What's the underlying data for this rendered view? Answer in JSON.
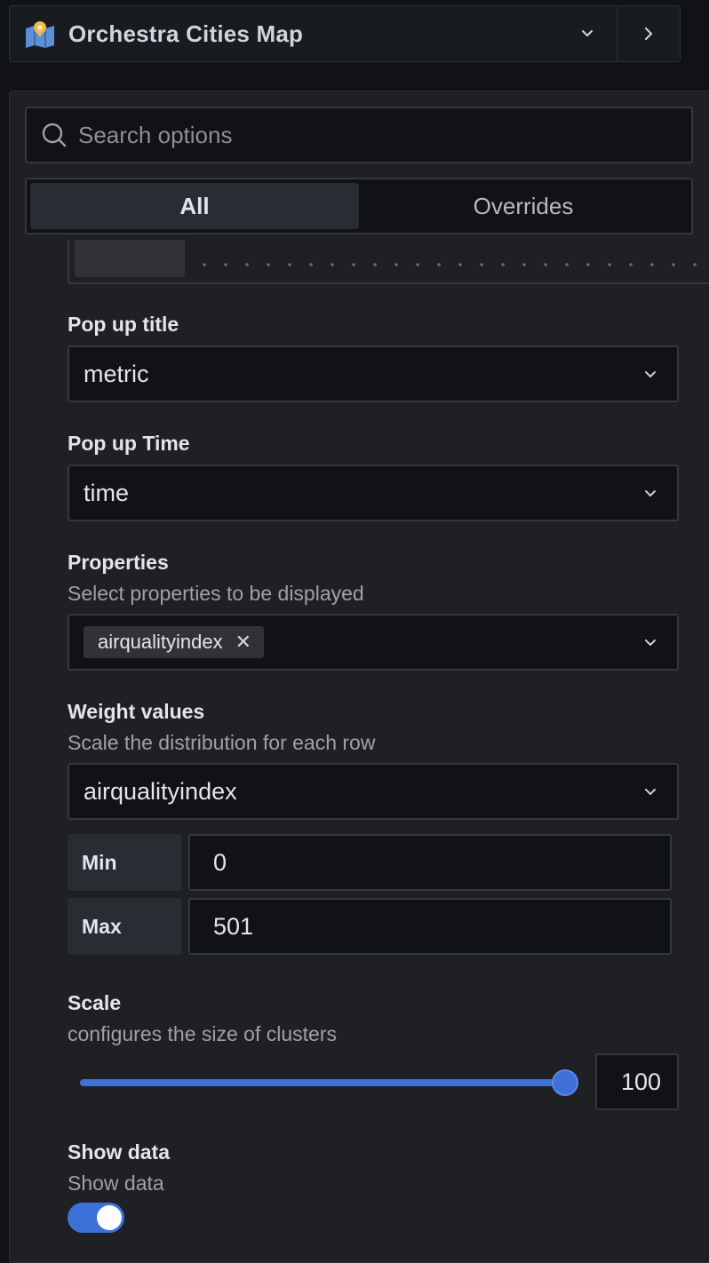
{
  "header": {
    "title": "Orchestra Cities Map",
    "icon": "map-pin-icon"
  },
  "search": {
    "placeholder": "Search options",
    "value": ""
  },
  "tabs": [
    {
      "label": "All",
      "active": true
    },
    {
      "label": "Overrides",
      "active": false
    }
  ],
  "options": {
    "popup_title": {
      "label": "Pop up title",
      "value": "metric"
    },
    "popup_time": {
      "label": "Pop up Time",
      "value": "time"
    },
    "properties": {
      "label": "Properties",
      "description": "Select properties to be displayed",
      "selected": [
        "airqualityindex"
      ]
    },
    "weight_values": {
      "label": "Weight values",
      "description": "Scale the distribution for each row",
      "value": "airqualityindex",
      "min_label": "Min",
      "min_value": "0",
      "max_label": "Max",
      "max_value": "501"
    },
    "scale": {
      "label": "Scale",
      "description": "configures the size of clusters",
      "value": "100",
      "fraction": 1.0
    },
    "show_data": {
      "label": "Show data",
      "description": "Show data",
      "enabled": true
    }
  },
  "colors": {
    "accent": "#3d71d9",
    "background": "#111217",
    "panel": "#1f2024"
  }
}
